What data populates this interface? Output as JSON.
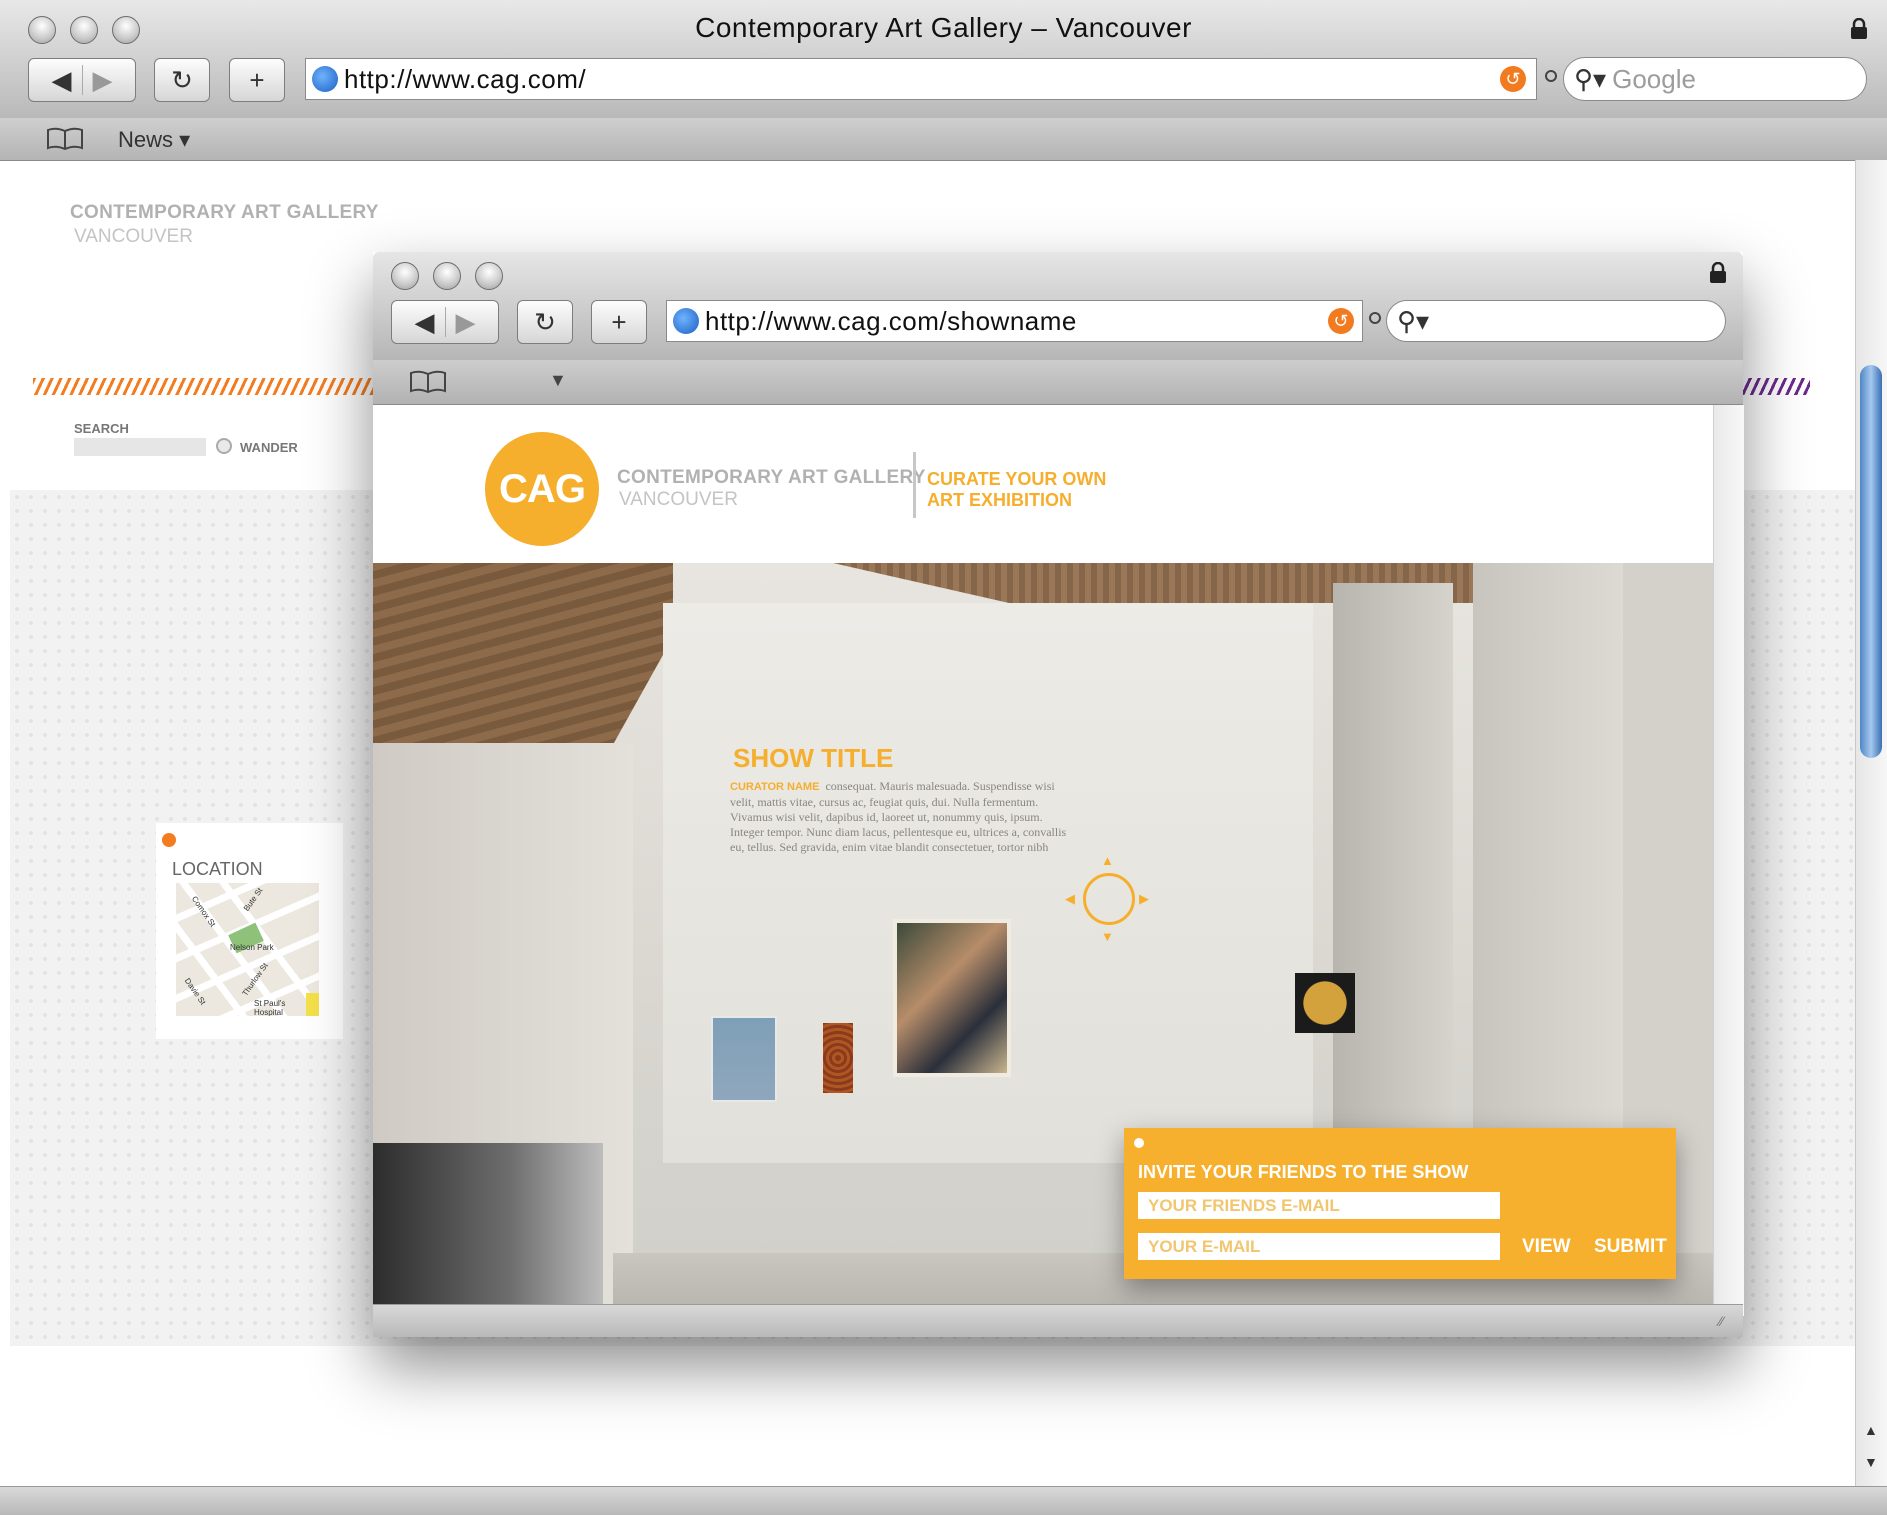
{
  "outer_browser": {
    "title": "Contemporary Art Gallery – Vancouver",
    "url": "http://www.cag.com/",
    "search_placeholder": "Google",
    "bookmark_menu": "News ▾"
  },
  "outer_page": {
    "brand_name": "CONTEMPORARY ART GALLERY",
    "brand_city": "VANCOUVER",
    "search_label": "SEARCH",
    "wander_label": "WANDER",
    "location_label": "LOCATION",
    "map_labels": [
      "Comox St",
      "Bute St",
      "Nelson Park",
      "Davie St",
      "Thurlow St",
      "St Paul's Hospital"
    ]
  },
  "inner_browser": {
    "url": "http://www.cag.com/showname"
  },
  "inner_page": {
    "logo_text": "CAG",
    "brand_name": "CONTEMPORARY ART GALLERY",
    "brand_city": "VANCOUVER",
    "tagline_line1": "CURATE YOUR OWN",
    "tagline_line2": "ART EXHIBITION",
    "show_title": "SHOW TITLE",
    "curator_label": "CURATOR NAME",
    "description_lines": [
      "consequat.  Mauris malesuada. Suspendisse wisi",
      "velit, mattis vitae, cursus ac, feugiat quis, dui. Nulla fermentum.",
      "Vivamus wisi velit, dapibus id, laoreet ut, nonummy quis, ipsum.",
      "Integer tempor. Nunc diam lacus, pellentesque eu, ultrices a, convallis",
      "eu, tellus. Sed gravida, enim vitae blandit consectetuer, tortor nibh"
    ],
    "invite": {
      "heading": "INVITE YOUR FRIENDS TO THE SHOW",
      "friends_email_placeholder": "YOUR FRIENDS E-MAIL",
      "your_email_placeholder": "YOUR E-MAIL",
      "view_label": "VIEW",
      "submit_label": "SUBMIT"
    }
  },
  "colors": {
    "accent_orange": "#f6ae2d",
    "stripe_orange": "#f47c20",
    "stripe_purple": "#6b2a8e"
  }
}
